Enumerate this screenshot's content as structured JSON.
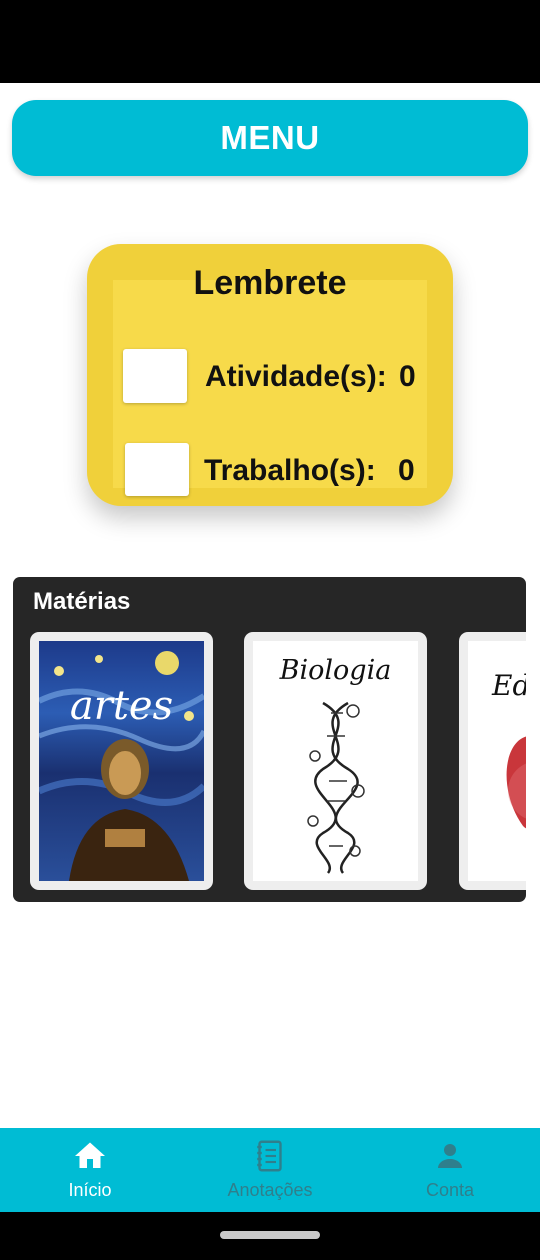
{
  "header": {
    "menu_label": "MENU"
  },
  "reminder": {
    "title": "Lembrete",
    "items": [
      {
        "label": "Atividade(s):",
        "count": "0"
      },
      {
        "label": "Trabalho(s):",
        "count": "0"
      }
    ]
  },
  "subjects": {
    "title": "Matérias",
    "cards": [
      {
        "cover_text": "artes"
      },
      {
        "cover_text": "Biologia"
      },
      {
        "cover_text": "Ed"
      }
    ]
  },
  "bottom_nav": {
    "items": [
      {
        "label": "Início",
        "icon": "home-icon",
        "active": true
      },
      {
        "label": "Anotações",
        "icon": "notebook-icon",
        "active": false
      },
      {
        "label": "Conta",
        "icon": "person-icon",
        "active": false
      }
    ]
  },
  "colors": {
    "accent": "#00bcd4",
    "reminder_bg": "#f7da4a",
    "subjects_bg": "#262626"
  }
}
